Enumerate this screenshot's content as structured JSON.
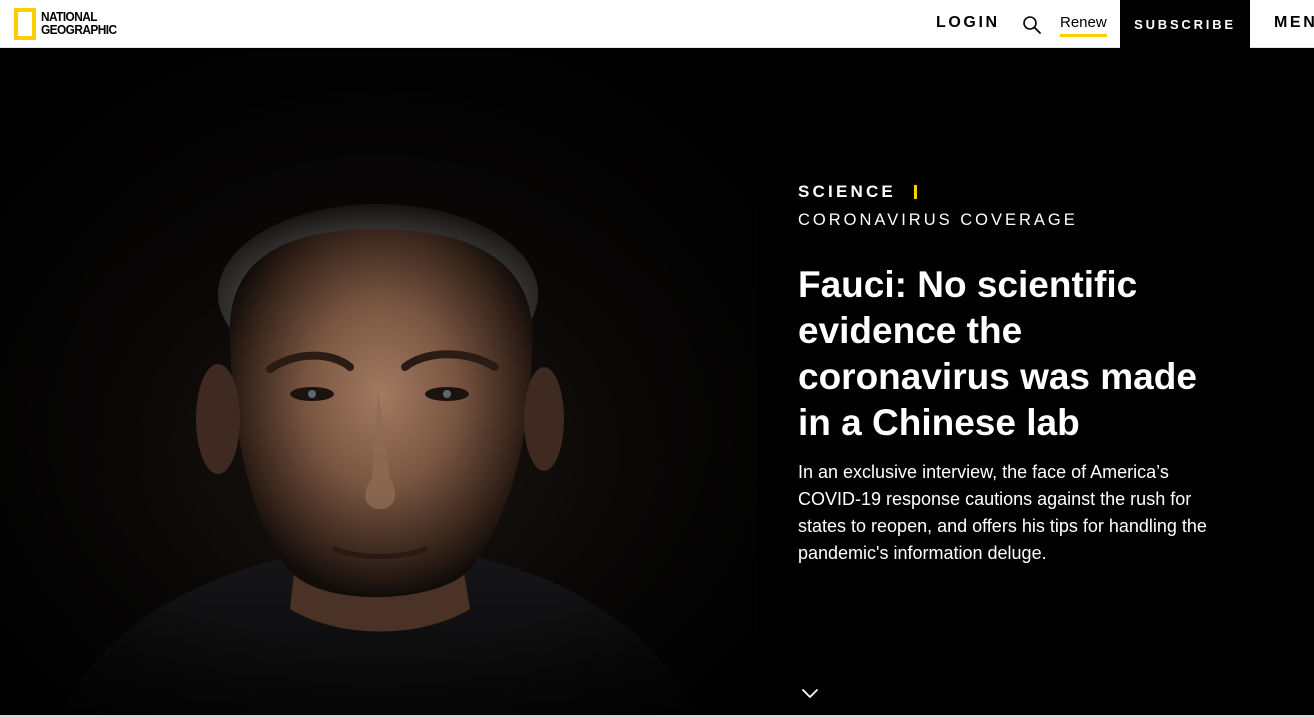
{
  "header": {
    "logo_line1": "NATIONAL",
    "logo_line2": "GEOGRAPHIC",
    "login_label": "LOGIN",
    "search_icon": "search-icon",
    "renew_label": "Renew",
    "subscribe_label": "SUBSCRIBE",
    "menu_label": "MENU"
  },
  "article": {
    "section": "SCIENCE",
    "series": "CORONAVIRUS COVERAGE",
    "headline": "Fauci: No scientific evidence the coronavirus was made in a Chinese lab",
    "dek": "In an exclusive interview, the face of America’s COVID-19 response cautions against the rush for states to reopen, and offers his tips for handling the pandemic's information deluge.",
    "scroll_icon": "chevron-down-icon"
  },
  "colors": {
    "brand_yellow": "#ffce00",
    "background": "#000000",
    "header_bg": "#ffffff"
  }
}
